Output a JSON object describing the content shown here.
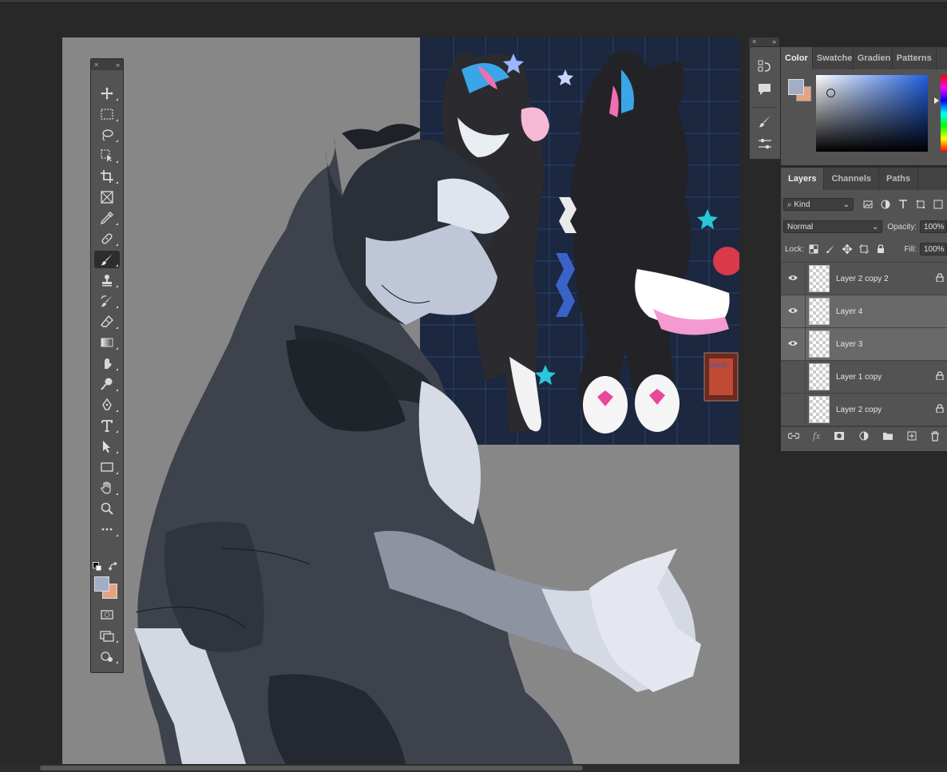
{
  "tools_panel": {
    "close_glyph": "×",
    "collapse_glyph": "»"
  },
  "mini_panel": {
    "close_glyph": "×",
    "collapse_glyph": "»"
  },
  "color_panel": {
    "tabs": [
      "Color",
      "Swatches",
      "Gradients",
      "Patterns"
    ],
    "tab_display": [
      "Color",
      "Swatche",
      "Gradien",
      "Patterns"
    ],
    "foreground_color": "#a3adc6",
    "background_color": "#e5a47f"
  },
  "layers_panel": {
    "tabs": [
      "Layers",
      "Channels",
      "Paths"
    ],
    "filter_kind": "Kind",
    "blend_mode": "Normal",
    "opacity_label": "Opacity:",
    "opacity_value": "100%",
    "lock_label": "Lock:",
    "fill_label": "Fill:",
    "fill_value": "100%",
    "layers": [
      {
        "name": "Layer 2 copy 2",
        "visible": true,
        "selected": false,
        "locked": true
      },
      {
        "name": "Layer 4",
        "visible": true,
        "selected": true,
        "locked": false
      },
      {
        "name": "Layer 3",
        "visible": true,
        "selected": true,
        "locked": false
      },
      {
        "name": "Layer 1 copy",
        "visible": false,
        "selected": false,
        "locked": true
      },
      {
        "name": "Layer 2 copy",
        "visible": false,
        "selected": false,
        "locked": true
      }
    ]
  },
  "reference_card_text": "MAGIC"
}
